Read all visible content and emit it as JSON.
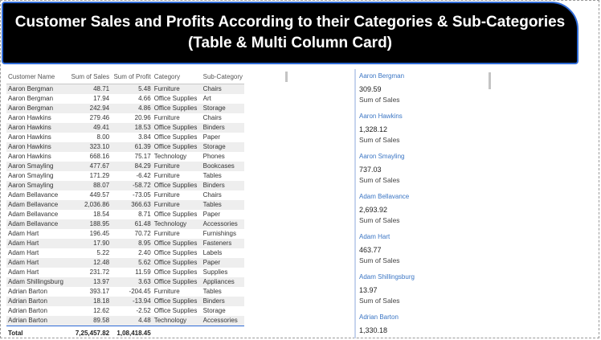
{
  "title": {
    "line1": "Customer Sales and Profits According to their Categories & Sub-Categories",
    "line2": "(Table & Multi Column Card)"
  },
  "table": {
    "headers": [
      "Customer Name",
      "Sum of Sales",
      "Sum of Profit",
      "Category",
      "Sub-Category"
    ],
    "rows": [
      [
        "Aaron Bergman",
        "48.71",
        "5.48",
        "Furniture",
        "Chairs"
      ],
      [
        "Aaron Bergman",
        "17.94",
        "4.66",
        "Office Supplies",
        "Art"
      ],
      [
        "Aaron Bergman",
        "242.94",
        "4.86",
        "Office Supplies",
        "Storage"
      ],
      [
        "Aaron Hawkins",
        "279.46",
        "20.96",
        "Furniture",
        "Chairs"
      ],
      [
        "Aaron Hawkins",
        "49.41",
        "18.53",
        "Office Supplies",
        "Binders"
      ],
      [
        "Aaron Hawkins",
        "8.00",
        "3.84",
        "Office Supplies",
        "Paper"
      ],
      [
        "Aaron Hawkins",
        "323.10",
        "61.39",
        "Office Supplies",
        "Storage"
      ],
      [
        "Aaron Hawkins",
        "668.16",
        "75.17",
        "Technology",
        "Phones"
      ],
      [
        "Aaron Smayling",
        "477.67",
        "84.29",
        "Furniture",
        "Bookcases"
      ],
      [
        "Aaron Smayling",
        "171.29",
        "-6.42",
        "Furniture",
        "Tables"
      ],
      [
        "Aaron Smayling",
        "88.07",
        "-58.72",
        "Office Supplies",
        "Binders"
      ],
      [
        "Adam Bellavance",
        "449.57",
        "-73.05",
        "Furniture",
        "Chairs"
      ],
      [
        "Adam Bellavance",
        "2,036.86",
        "366.63",
        "Furniture",
        "Tables"
      ],
      [
        "Adam Bellavance",
        "18.54",
        "8.71",
        "Office Supplies",
        "Paper"
      ],
      [
        "Adam Bellavance",
        "188.95",
        "61.48",
        "Technology",
        "Accessories"
      ],
      [
        "Adam Hart",
        "196.45",
        "70.72",
        "Furniture",
        "Furnishings"
      ],
      [
        "Adam Hart",
        "17.90",
        "8.95",
        "Office Supplies",
        "Fasteners"
      ],
      [
        "Adam Hart",
        "5.22",
        "2.40",
        "Office Supplies",
        "Labels"
      ],
      [
        "Adam Hart",
        "12.48",
        "5.62",
        "Office Supplies",
        "Paper"
      ],
      [
        "Adam Hart",
        "231.72",
        "11.59",
        "Office Supplies",
        "Supplies"
      ],
      [
        "Adam Shillingsburg",
        "13.97",
        "3.63",
        "Office Supplies",
        "Appliances"
      ],
      [
        "Adrian Barton",
        "393.17",
        "-204.45",
        "Furniture",
        "Tables"
      ],
      [
        "Adrian Barton",
        "18.18",
        "-13.94",
        "Office Supplies",
        "Binders"
      ],
      [
        "Adrian Barton",
        "12.62",
        "-2.52",
        "Office Supplies",
        "Storage"
      ],
      [
        "Adrian Barton",
        "89.58",
        "4.48",
        "Technology",
        "Accessories"
      ]
    ],
    "total": {
      "label": "Total",
      "sales": "7,25,457.82",
      "profit": "1,08,418.45"
    }
  },
  "cards": [
    {
      "name": "Aaron Bergman",
      "value": "309.59",
      "label": "Sum of Sales"
    },
    {
      "name": "Aaron Hawkins",
      "value": "1,328.12",
      "label": "Sum of Sales"
    },
    {
      "name": "Aaron Smayling",
      "value": "737.03",
      "label": "Sum of Sales"
    },
    {
      "name": "Adam Bellavance",
      "value": "2,693.92",
      "label": "Sum of Sales"
    },
    {
      "name": "Adam Hart",
      "value": "463.77",
      "label": "Sum of Sales"
    },
    {
      "name": "Adam Shillingsburg",
      "value": "13.97",
      "label": "Sum of Sales"
    },
    {
      "name": "Adrian Barton",
      "value": "1,330.18",
      "label": "Sum of Sales"
    }
  ],
  "colors": {
    "title_background": "#000000",
    "title_border": "#2f6bd6",
    "card_name": "#3a75c4",
    "row_stripe": "#eeeeee"
  }
}
